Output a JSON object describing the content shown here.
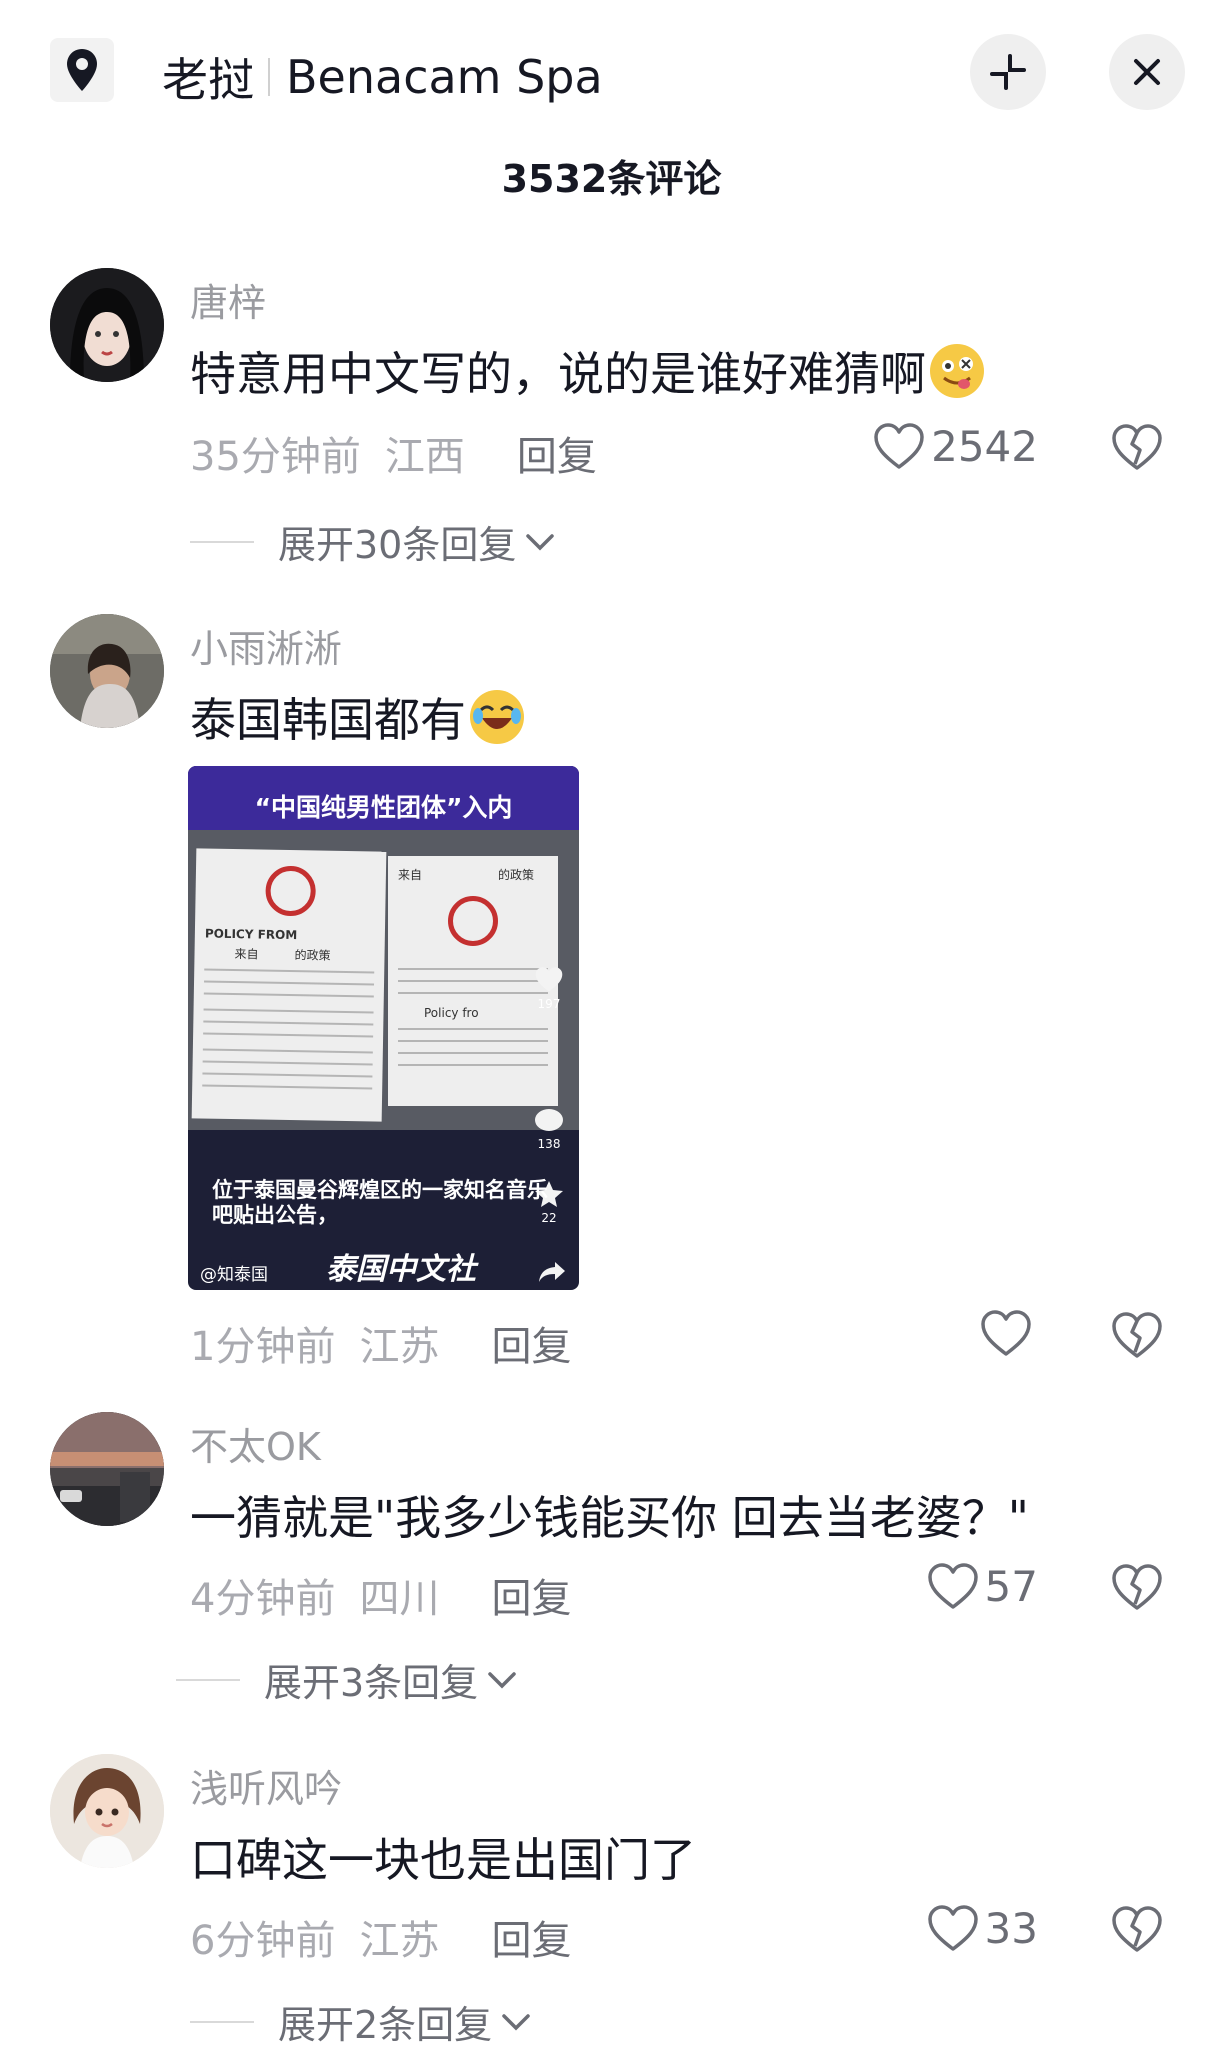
{
  "header": {
    "location_name": "老挝",
    "place_name": "Benacam Spa",
    "location_icon": "location-pin-icon",
    "collapse_icon": "collapse-icon",
    "close_icon": "close-icon"
  },
  "comment_count_title": "3532条评论",
  "comments": [
    {
      "username": "唐梓",
      "text": "特意用中文写的，说的是谁好难猜啊",
      "emoji": "drooling-face-emoji",
      "time": "35分钟前",
      "location": "江西",
      "reply_label": "回复",
      "likes": "2542",
      "expand_label": "展开30条回复"
    },
    {
      "username": "小雨淅淅",
      "text": "泰国韩国都有",
      "emoji": "rolling-laughing-emoji",
      "time": "1分钟前",
      "location": "江苏",
      "reply_label": "回复",
      "likes": "",
      "image": {
        "banner": "“中国纯男性团体”入内",
        "paper_left_title": "POLICY FROM",
        "paper_left_sub": "来自",
        "paper_left_sub2": "的政策",
        "paper_right_title": "来自",
        "paper_right_sub": "的政策",
        "paper_right_policy": "Policy fro",
        "caption_line1": "位于泰国曼谷辉煌区的一家知名音乐",
        "caption_line2": "吧贴出公告，",
        "handle": "@知泰国",
        "brand": "泰国中文社",
        "side_likes": "197",
        "side_comments": "138",
        "side_favs": "22"
      }
    },
    {
      "username": "不太OK",
      "text": "一猜就是\"我多少钱能买你 回去当老婆？\"",
      "time": "4分钟前",
      "location": "四川",
      "reply_label": "回复",
      "likes": "57",
      "expand_label": "展开3条回复"
    },
    {
      "username": "浅听风吟",
      "text": "口碑这一块也是出国门了",
      "time": "6分钟前",
      "location": "江苏",
      "reply_label": "回复",
      "likes": "33",
      "expand_label": "展开2条回复"
    }
  ],
  "colors": {
    "text_primary": "#161823",
    "text_secondary": "#9a9ba0",
    "banner_purple": "#3c2a9a",
    "no_sign_red": "#c43030"
  }
}
